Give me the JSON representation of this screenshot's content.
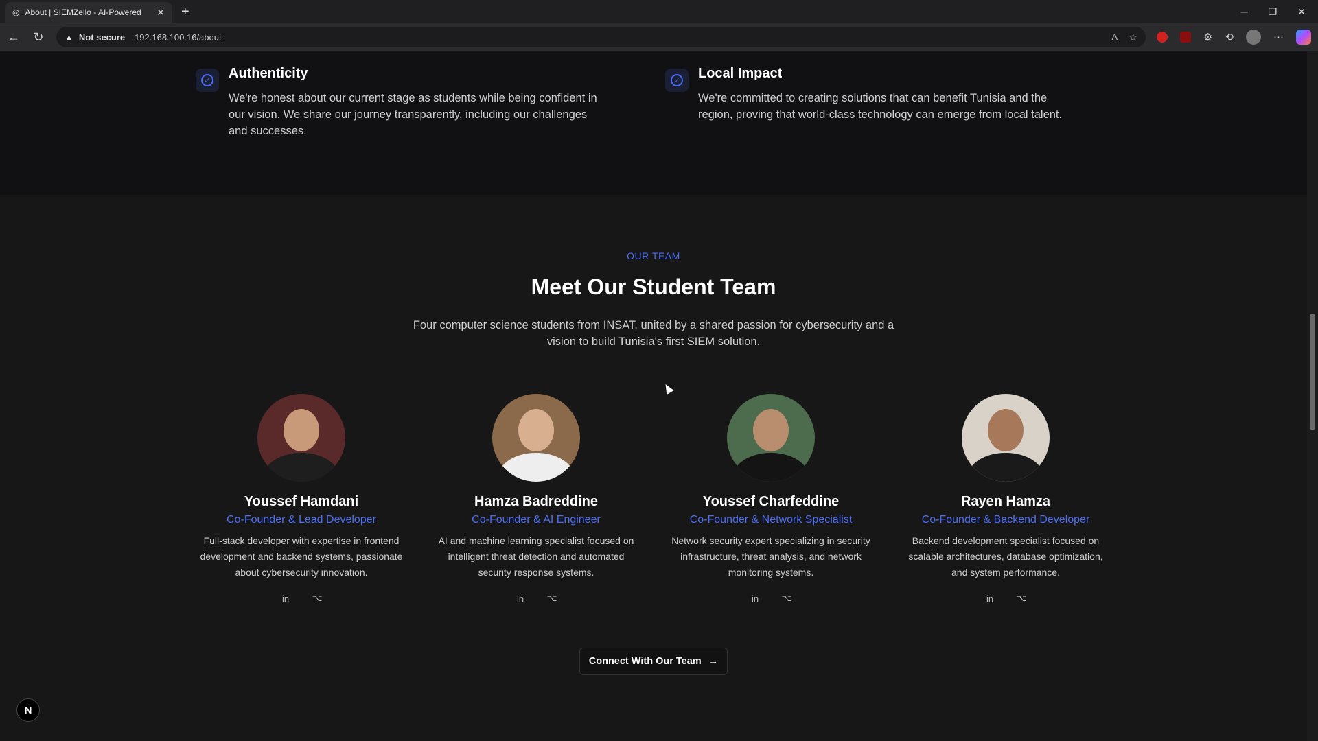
{
  "browser": {
    "tab_title": "About | SIEMZello - AI-Powered",
    "security_label": "Not secure",
    "url": "192.168.100.16/about"
  },
  "values": [
    {
      "title": "Authenticity",
      "text": "We're honest about our current stage as students while being confident in our vision. We share our journey transparently, including our challenges and successes."
    },
    {
      "title": "Local Impact",
      "text": "We're committed to creating solutions that can benefit Tunisia and the region, proving that world-class technology can emerge from local talent."
    }
  ],
  "team": {
    "eyebrow": "OUR TEAM",
    "heading": "Meet Our Student Team",
    "subtitle": "Four computer science students from INSAT, united by a shared passion for cybersecurity and a vision to build Tunisia's first SIEM solution.",
    "members": [
      {
        "name": "Youssef Hamdani",
        "role": "Co-Founder & Lead Developer",
        "bio": "Full-stack developer with expertise in frontend development and backend systems, passionate about cybersecurity innovation."
      },
      {
        "name": "Hamza Badreddine",
        "role": "Co-Founder & AI Engineer",
        "bio": "AI and machine learning specialist focused on intelligent threat detection and automated security response systems."
      },
      {
        "name": "Youssef Charfeddine",
        "role": "Co-Founder & Network Specialist",
        "bio": "Network security expert specializing in security infrastructure, threat analysis, and network monitoring systems."
      },
      {
        "name": "Rayen Hamza",
        "role": "Co-Founder & Backend Developer",
        "bio": "Backend development specialist focused on scalable architectures, database optimization, and system performance."
      }
    ],
    "cta_label": "Connect With Our Team"
  },
  "floating_badge": "N",
  "colors": {
    "accent": "#4b6df5",
    "background": "#171717",
    "values_bg": "#111113"
  },
  "icons": [
    "globe-icon",
    "linkedin-icon",
    "github-icon",
    "arrow-right-icon",
    "check-circle-icon"
  ]
}
